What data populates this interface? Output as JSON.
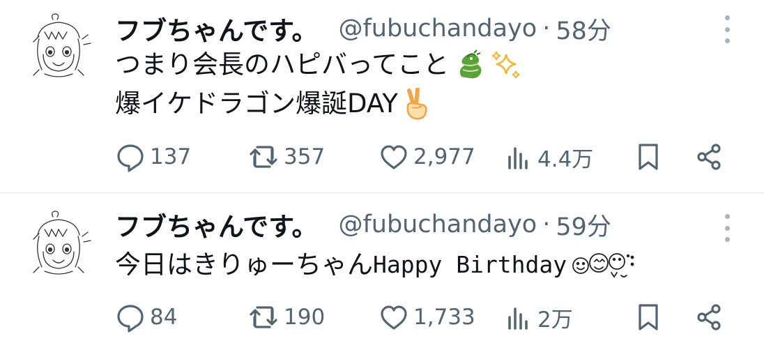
{
  "colors": {
    "text": "#0f1419",
    "secondary": "#536471",
    "divider": "#e1e5e8",
    "dragon": "#5aa33a",
    "sparkle": "#f2b632",
    "victory_hand": "#f5a445"
  },
  "tweets": [
    {
      "author": "フブちゃんです。",
      "handle": "@fubuchandayo",
      "separator": "·",
      "time": "58分",
      "text_line1": "つまり会長のハピバってこと",
      "text_line1_emojis": [
        "dragon-emoji",
        "sparkles-emoji"
      ],
      "text_line2": "爆イケドラゴン爆誕DAY",
      "text_line2_emojis": [
        "victory-hand-emoji"
      ],
      "replies": "137",
      "retweets": "357",
      "likes": "2,977",
      "views": "4.4万",
      "icons": [
        "reply-icon",
        "retweet-icon",
        "like-icon",
        "views-icon",
        "bookmark-icon",
        "share-icon",
        "more-options-icon"
      ]
    },
    {
      "author": "フブちゃんです。",
      "handle": "@fubuchandayo",
      "separator": "·",
      "time": "59分",
      "text_jp": "今日はきりゅーちゃん",
      "text_en": "Happy Birthday",
      "text_emojis": [
        "kaomoji-faces"
      ],
      "replies": "84",
      "retweets": "190",
      "likes": "1,733",
      "views": "2万",
      "icons": [
        "reply-icon",
        "retweet-icon",
        "like-icon",
        "views-icon",
        "bookmark-icon",
        "share-icon",
        "more-options-icon"
      ]
    }
  ]
}
